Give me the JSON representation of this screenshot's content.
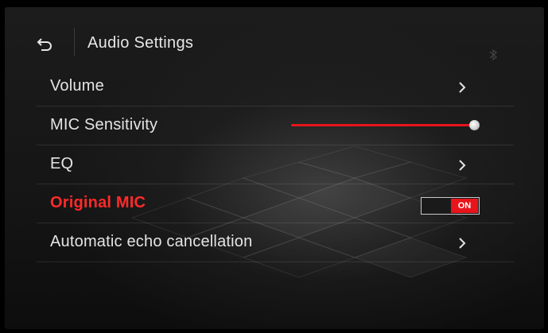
{
  "header": {
    "title": "Audio Settings",
    "back_icon": "back-arrow-icon"
  },
  "menu": {
    "items": [
      {
        "label": "Volume",
        "control": "chevron"
      },
      {
        "label": "MIC Sensitivity",
        "control": "slider",
        "value_percent": 100
      },
      {
        "label": "EQ",
        "control": "chevron"
      },
      {
        "label": "Original MIC",
        "control": "toggle",
        "toggle_text": "ON",
        "highlighted": true
      },
      {
        "label": "Automatic echo cancellation",
        "control": "chevron"
      }
    ]
  },
  "colors": {
    "accent": "#e8141b",
    "text": "#e4e4e4",
    "highlight_text": "#ff2a2a"
  }
}
